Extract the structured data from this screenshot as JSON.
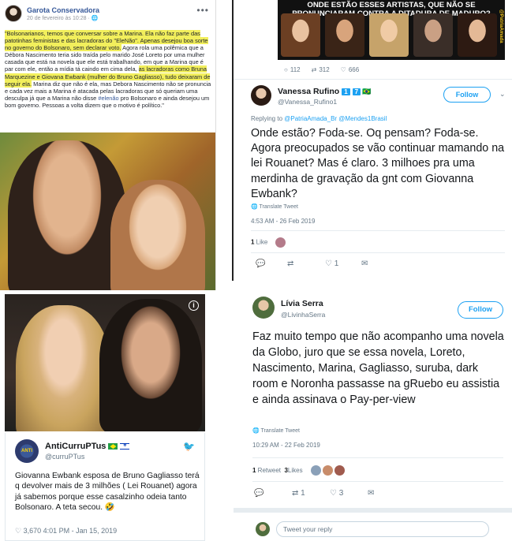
{
  "facebook": {
    "author": "Garota Conservadora",
    "date": "20 de fevereiro às 10:28 · 🌐",
    "more_icon": "ellipsis-icon",
    "text_parts": [
      {
        "t": "\"Bolsonarianos, temos que conversar sobre a Marina. Ela não faz parte das patotinhas feministas e das lacradoras do \"EleNão\". Apenas desejou boa sorte no governo do Bolsonaro, sem declarar voto.",
        "hl": true
      },
      {
        "t": " Agora rola uma polêmica que a Débora Nascimento teria sido traída pelo marido José Loreto por uma mulher casada que está na novela que ele está trabalhando, em que a Marina que é par com ele, então a mídia tá caindo em cima dela, ",
        "hl": false
      },
      {
        "t": "as lacradoras como Bruna Marquezine e Giovana Ewbank (mulher do Bruno Gagliasso), tudo deixaram de seguir ela.",
        "hl": true
      },
      {
        "t": " Marina diz que não é ela, mas Debora Nascimento não se pronuncia e cada vez mais a Marina é atacada pelas lacradoras que só queriam uma desculpa já que a Marina não disse ",
        "hl": false
      },
      {
        "t": "#elenão",
        "tag": true
      },
      {
        "t": " pro Bolsonaro e ainda desejou um bom governo. Pessoas a volta dizem que o motivo é político.\"",
        "hl": false
      }
    ]
  },
  "tweet_left": {
    "info_icon": "info-icon",
    "name": "AntiCurruPTus",
    "handle": "@curruPTus",
    "avatar_text": "ANTI",
    "bird_icon": "twitter-bird-icon",
    "text": "Giovanna Ewbank esposa de Bruno Gagliasso terá q devolver mais de 3 milhões ( Lei Rouanet) agora já sabemos porque esse casalzinho odeia tanto Bolsonaro. A teta secou. 🤣",
    "footer": "♡ 3,670   4:01 PM - Jan 15, 2019"
  },
  "tweet_top_right": {
    "banner_text": "ONDE ESTÃO ESSES ARTISTAS, QUE NÃO SE PRONUNCIARAM CONTRA A DITADURA DE MADURO?",
    "banner_handle": "@PatriaAmada",
    "stats": {
      "replies": "112",
      "retweets": "312",
      "likes": "666"
    },
    "name": "Vanessa Rufino",
    "badge_a": "1",
    "badge_b": "7",
    "badge_c": "🇧🇷",
    "handle": "@Vanessa_Rufino1",
    "follow_label": "Follow",
    "reply_prefix": "Replying to ",
    "reply_targets": "@PatriaAmada_Br @Mendes1Brasil",
    "text": "Onde estão? Foda-se. Oq pensam? Foda-se. Agora preocupados se vão continuar mamando na lei Rouanet? Mas é claro. 3 milhoes pra uma merdinha de gravação da gnt com Giovanna Ewbank?",
    "translate": "🌐 Translate Tweet",
    "time": "4:53 AM - 26 Feb 2019",
    "likes_count": "1",
    "likes_label": " Like",
    "action_reply": "💬",
    "action_retweet": "⇄",
    "action_like": "♡ 1",
    "action_mail": "✉"
  },
  "tweet_bottom_right": {
    "name": "Lívia Serra",
    "handle": "@LivinhaSerra",
    "follow_label": "Follow",
    "text": "Faz muito tempo que não acompanho uma novela da Globo, juro que se essa novela, Loreto, Nascimento, Marina, Gagliasso, suruba, dark room e Noronha passasse na gRuebo eu assistia e ainda assinava o Pay-per-view",
    "translate": "🌐 Translate Tweet",
    "time": "10:29 AM - 22 Feb 2019",
    "retweet_count": "1",
    "retweet_label": " Retweet  ",
    "likes_count": "3",
    "likes_label": " Likes",
    "action_reply": "💬",
    "action_retweet": "⇄ 1",
    "action_like": "♡ 3",
    "action_mail": "✉",
    "reply_placeholder": "Tweet your reply"
  }
}
